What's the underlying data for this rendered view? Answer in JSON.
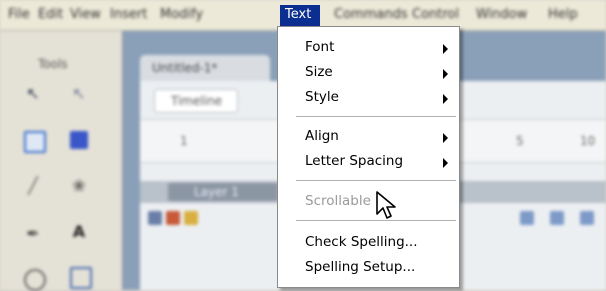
{
  "menubar": {
    "items": [
      "File",
      "Edit",
      "View",
      "Insert",
      "Modify",
      "Text",
      "Commands",
      "Control",
      "Window",
      "Help"
    ],
    "active": "Text"
  },
  "tools_panel": {
    "title": "Tools"
  },
  "document": {
    "tab_label": "Untitled-1*",
    "timeline_button": "Timeline",
    "ruler_numbers": [
      "1",
      "5",
      "10"
    ],
    "layer_name": "Layer 1"
  },
  "text_menu": {
    "items": [
      {
        "label": "Font",
        "submenu": true,
        "enabled": true
      },
      {
        "label": "Size",
        "submenu": true,
        "enabled": true
      },
      {
        "label": "Style",
        "submenu": true,
        "enabled": true
      },
      {
        "label": "Align",
        "submenu": true,
        "enabled": true
      },
      {
        "label": "Letter Spacing",
        "submenu": true,
        "enabled": true
      },
      {
        "label": "Scrollable",
        "submenu": false,
        "enabled": false
      },
      {
        "label": "Check Spelling...",
        "submenu": false,
        "enabled": true
      },
      {
        "label": "Spelling Setup...",
        "submenu": false,
        "enabled": true
      }
    ]
  },
  "colors": {
    "menu_highlight": "#0a2f91",
    "menu_background": "#ffffff",
    "disabled_text": "#9a9a9a"
  }
}
